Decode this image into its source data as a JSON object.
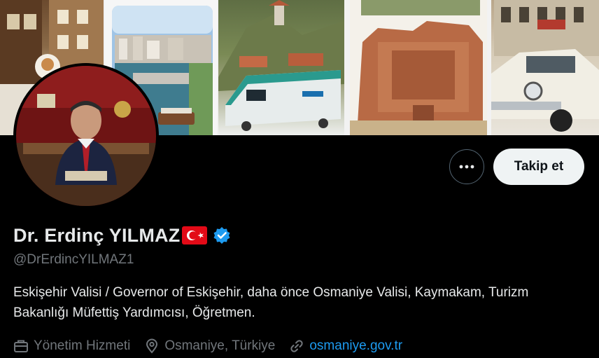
{
  "profile": {
    "display_name": "Dr. Erdinç YILMAZ",
    "handle": "@DrErdincYILMAZ1",
    "bio_line1": "Eskişehir Valisi / Governor of Eskişehir, daha önce Osmaniye Valisi, Kaymakam, Turizm",
    "bio_line2": "Bakanlığı Müfettiş Yardımcısı, Öğretmen.",
    "category": "Yönetim Hizmeti",
    "location": "Osmaniye, Türkiye",
    "website": "osmaniye.gov.tr"
  },
  "actions": {
    "follow_label": "Takip et",
    "more_label": "•••"
  },
  "icons": {
    "more": "more-dots-icon",
    "flag": "turkey-flag-icon",
    "verified": "verified-badge-icon",
    "category": "briefcase-icon",
    "location": "location-pin-icon",
    "website": "link-icon"
  },
  "colors": {
    "background": "#000000",
    "text_primary": "#e7e9ea",
    "text_secondary": "#71767b",
    "link": "#1d9bf0",
    "verified": "#1d9bf0",
    "follow_button_bg": "#eff3f4",
    "flag_red": "#e30a17"
  }
}
